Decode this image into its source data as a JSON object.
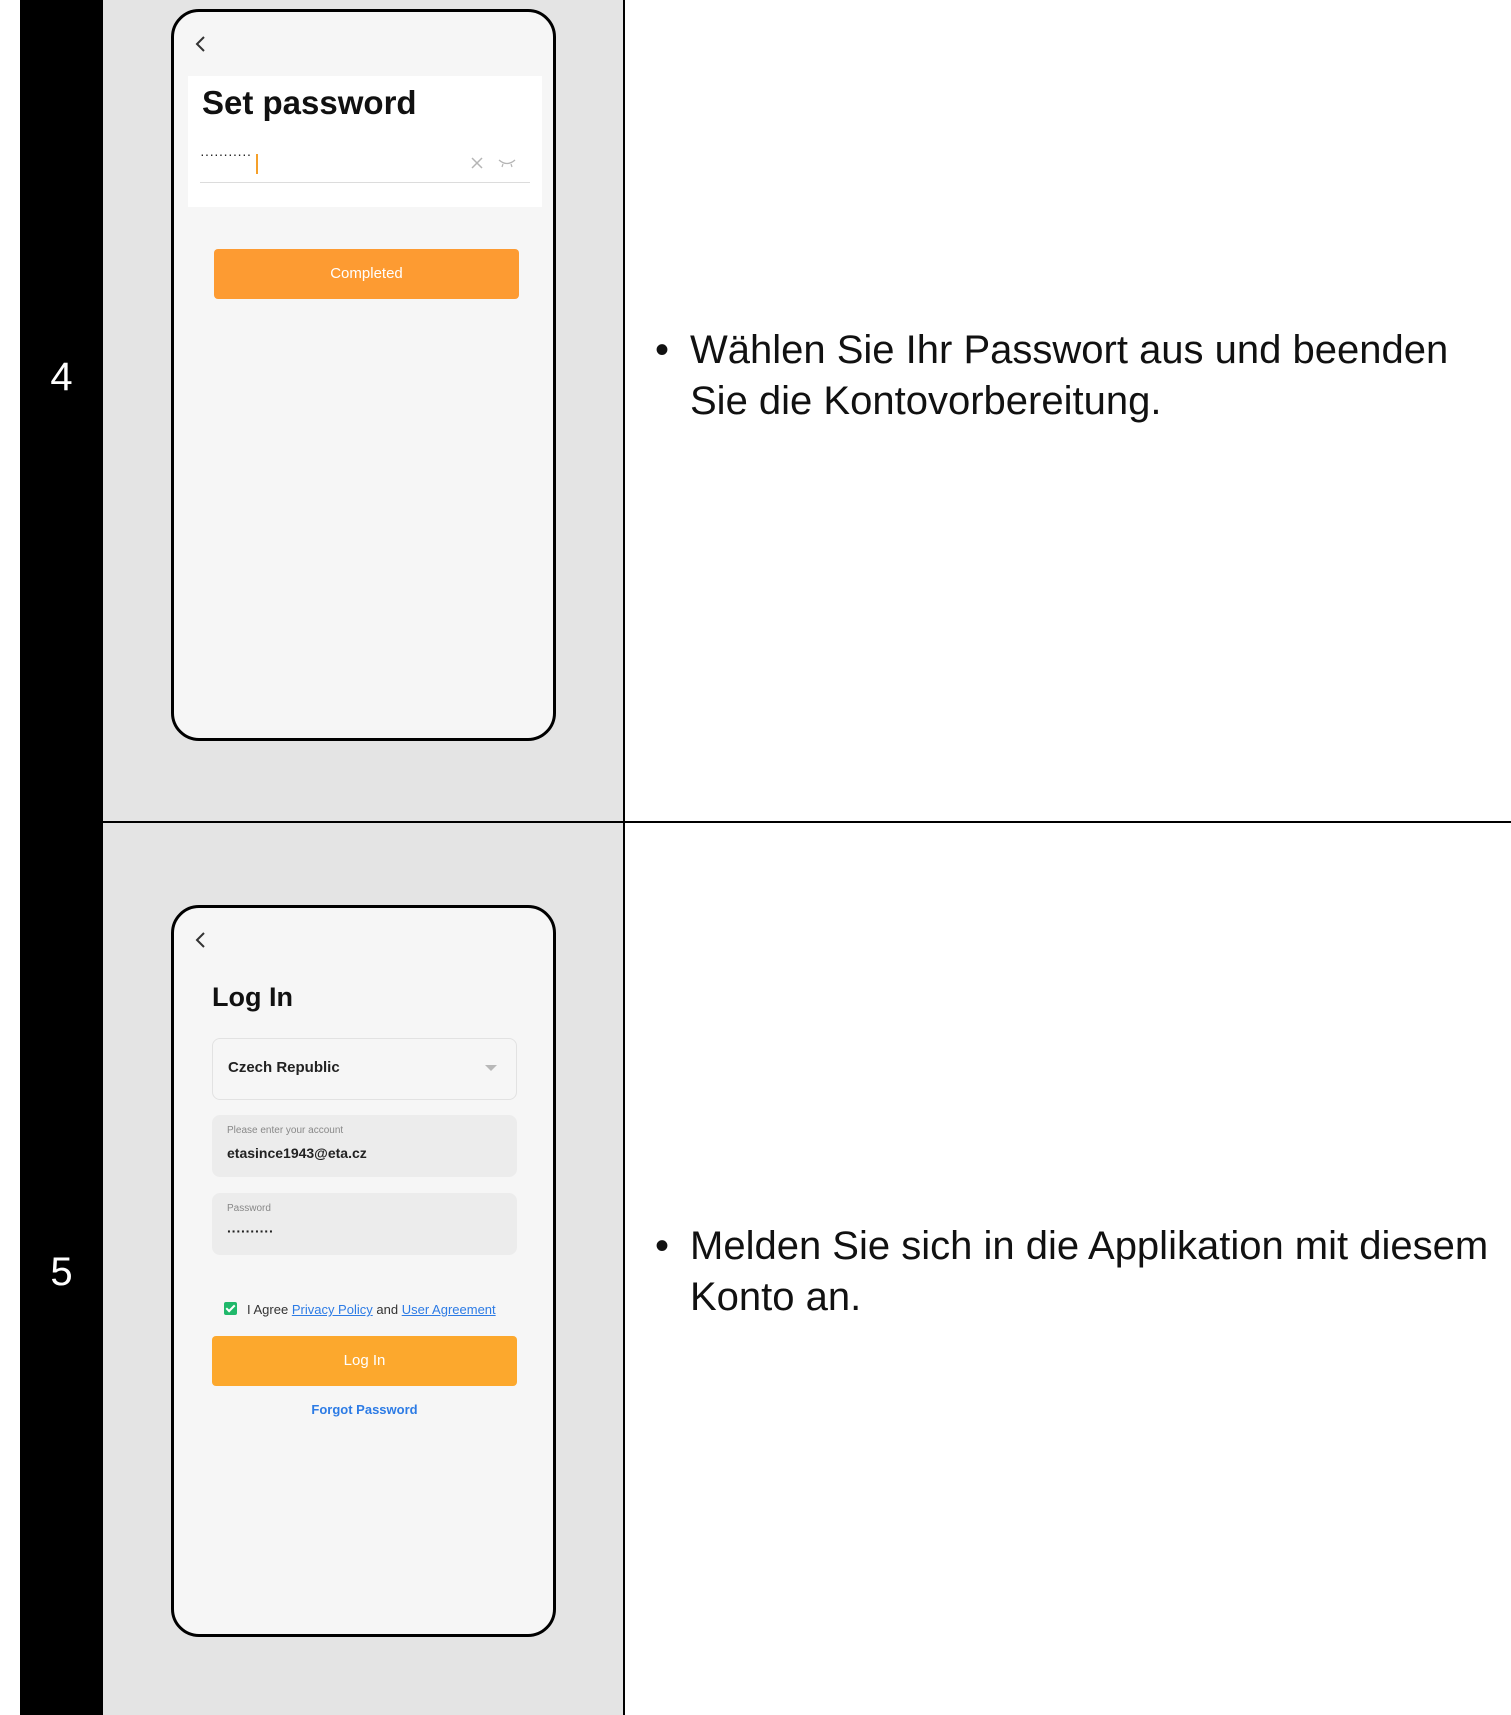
{
  "steps": [
    {
      "number": "4",
      "bullet": "Wählen Sie Ihr Passwort aus und beenden Sie die Kontovorbereitung.",
      "screen": {
        "title": "Set password",
        "password_value": "···········",
        "button_label": "Completed"
      }
    },
    {
      "number": "5",
      "bullet": "Melden Sie sich in die Applikation mit diesem Konto an.",
      "screen": {
        "title": "Log In",
        "country": "Czech Republic",
        "account_placeholder": "Please enter your account",
        "account_value": "etasince1943@eta.cz",
        "password_placeholder": "Password",
        "password_value": "··········",
        "agree_prefix": "I Agree",
        "privacy_link": "Privacy Policy",
        "agree_and": "and",
        "user_agreement_link": "User Agreement",
        "login_button": "Log In",
        "forgot_link": "Forgot Password"
      }
    }
  ],
  "bullet_symbol": "•",
  "colors": {
    "accent_orange": "#fd9b32",
    "link_blue": "#2c7be5",
    "check_green": "#1fb86a",
    "panel_gray": "#e4e4e4"
  }
}
